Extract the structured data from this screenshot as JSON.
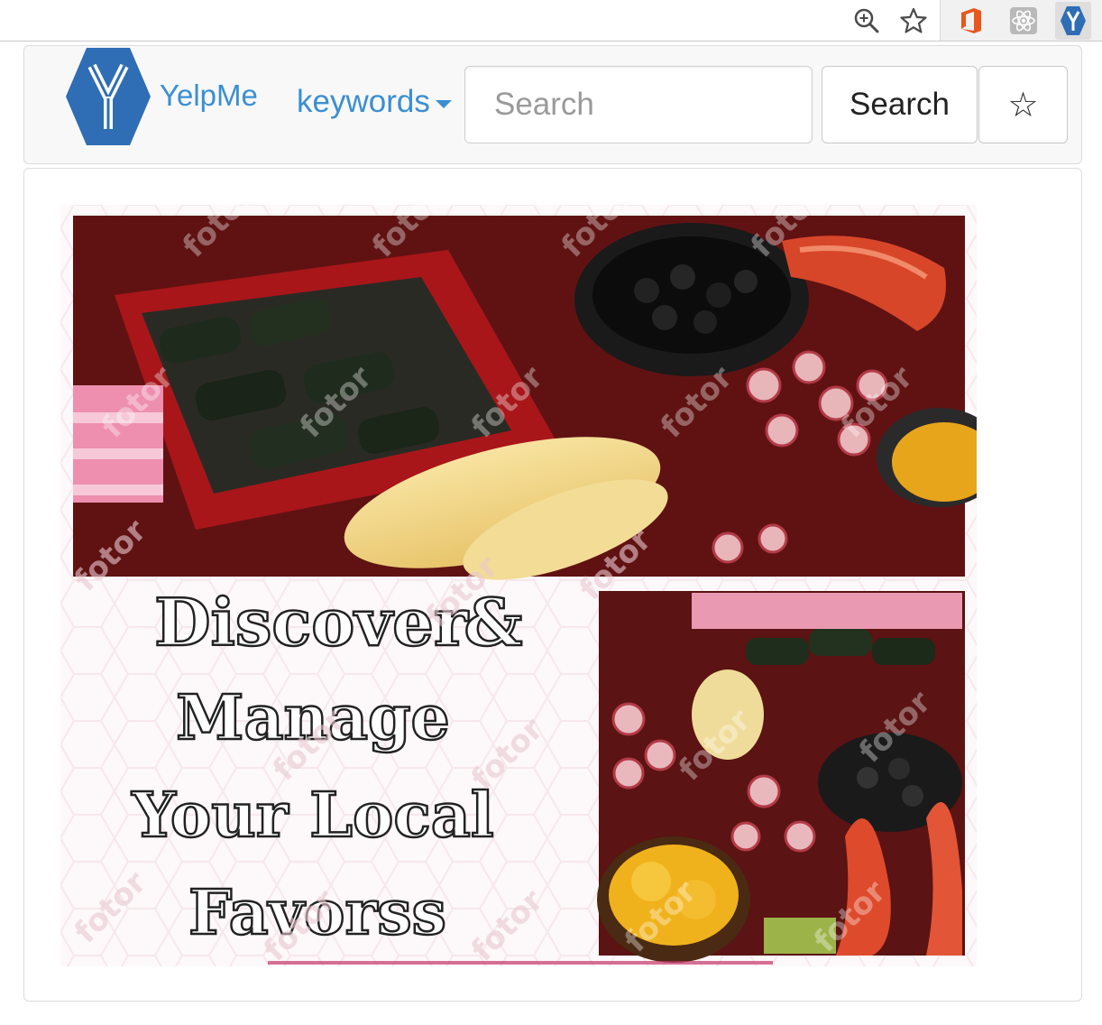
{
  "toolbar": {
    "icons": [
      "zoom-in-icon",
      "bookmark-star-icon",
      "office-extension-icon",
      "react-devtools-icon",
      "yelpme-extension-icon"
    ]
  },
  "navbar": {
    "brand_name": "YelpMe",
    "brand_logo_letter": "Y",
    "keywords_label": "keywords",
    "search_placeholder": "Search",
    "search_button_label": "Search",
    "favorites_button_label": "☆"
  },
  "banner": {
    "headline_lines": [
      "Discover &",
      "Manage",
      "Your Local",
      "Favorss"
    ],
    "watermark": "fotor"
  },
  "colors": {
    "brand_blue": "#2f6db5",
    "link_blue": "#3b8fd1",
    "navbar_bg": "#f8f8f8",
    "office_orange": "#e8571c"
  }
}
